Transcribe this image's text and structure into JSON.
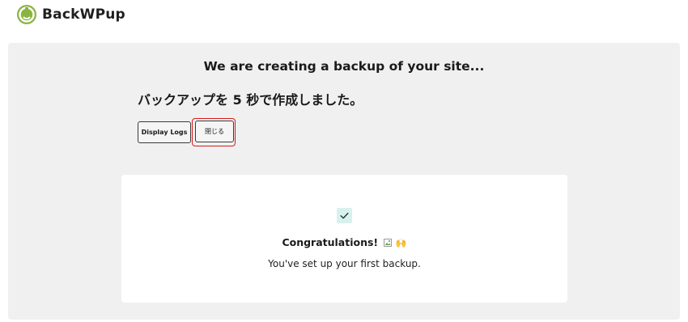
{
  "header": {
    "brand": "BackWPup",
    "logo_icon": "backwpup-logo-icon",
    "logo_color": "#8ab440"
  },
  "panel": {
    "headline": "We are creating a backup of your site...",
    "status_message": "バックアップを 5 秒で作成しました。",
    "buttons": {
      "display_logs": "Display Logs",
      "close": "閉じる"
    },
    "highlight_color": "#d91a1a"
  },
  "card": {
    "check_icon": "check-icon",
    "check_bg": "#d9f1ec",
    "congrats_title": "Congratulations!",
    "broken_image_icon": "broken-image-icon",
    "emoji": "🙌",
    "subtext": "You've set up your first backup."
  }
}
